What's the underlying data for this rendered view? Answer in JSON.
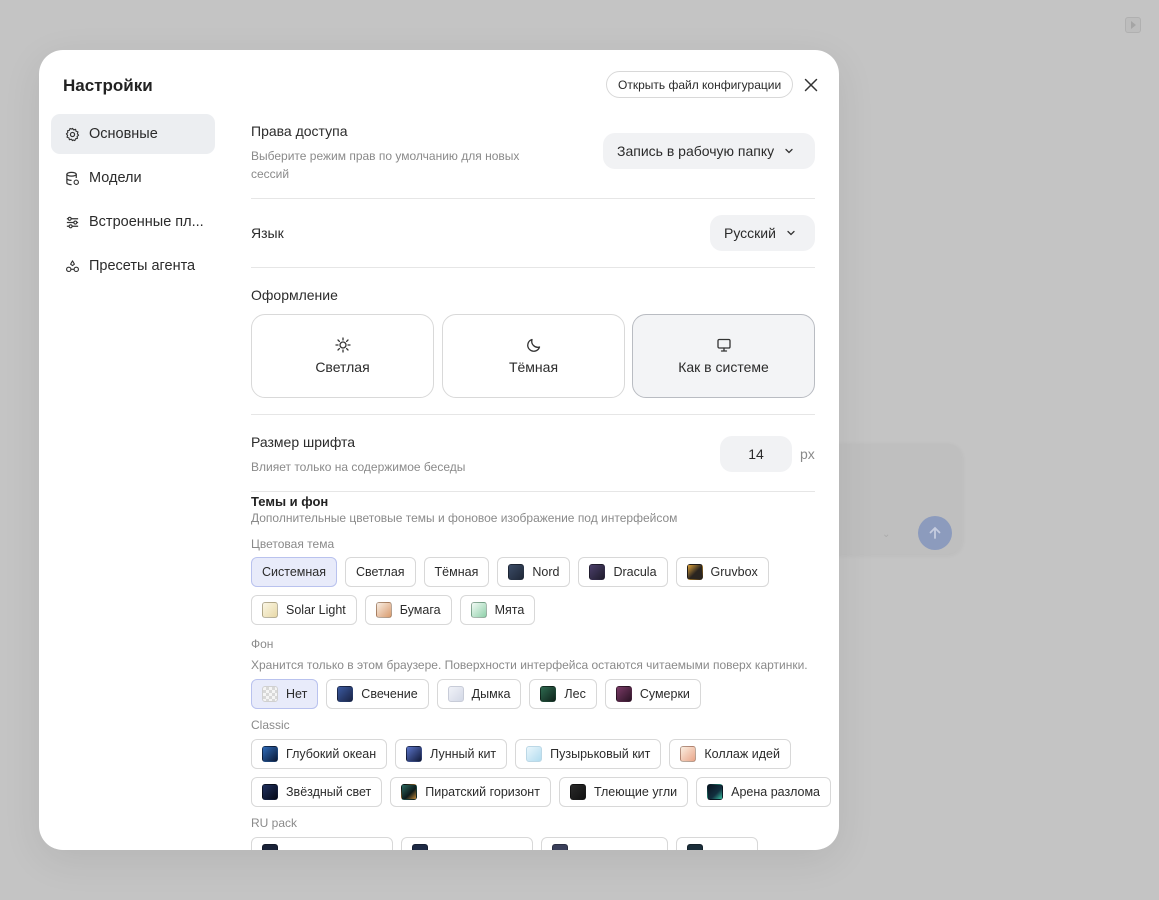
{
  "modal": {
    "title": "Настройки",
    "open_config_label": "Открыть файл конфигурации"
  },
  "sidebar": {
    "items": [
      {
        "label": "Основные",
        "icon": "gear-icon",
        "active": true
      },
      {
        "label": "Модели",
        "icon": "database-icon",
        "active": false
      },
      {
        "label": "Встроенные пл...",
        "icon": "sliders-icon",
        "active": false
      },
      {
        "label": "Пресеты агента",
        "icon": "agent-icon",
        "active": false
      }
    ]
  },
  "permissions": {
    "label": "Права доступа",
    "description": "Выберите режим прав по умолчанию для новых сессий",
    "value": "Запись в рабочую папку"
  },
  "language": {
    "label": "Язык",
    "value": "Русский"
  },
  "appearance": {
    "label": "Оформление",
    "options": [
      {
        "label": "Светлая",
        "icon": "sun-icon"
      },
      {
        "label": "Тёмная",
        "icon": "moon-icon"
      },
      {
        "label": "Как в системе",
        "icon": "monitor-icon",
        "selected": true
      }
    ]
  },
  "font_size": {
    "label": "Размер шрифта",
    "description": "Влияет только на содержимое беседы",
    "value": "14",
    "unit": "px"
  },
  "themes": {
    "title": "Темы и фон",
    "description": "Дополнительные цветовые темы и фоновое изображение под интерфейсом",
    "color_theme_label": "Цветовая тема",
    "color_themes_row1": [
      {
        "label": "Системная",
        "active": true
      },
      {
        "label": "Светлая"
      },
      {
        "label": "Тёмная"
      },
      {
        "label": "Nord",
        "swatch": "#2c3648"
      },
      {
        "label": "Dracula",
        "swatch": "#2b2740"
      },
      {
        "label": "Gruvbox",
        "swatch": "#2f2a1f"
      }
    ],
    "color_themes_row2": [
      {
        "label": "Solar Light",
        "swatch": "#f6efd6"
      },
      {
        "label": "Бумага",
        "swatch": "#f3e5d5"
      },
      {
        "label": "Мята",
        "swatch": "#dff2e6"
      }
    ],
    "background_label": "Фон",
    "background_description": "Хранится только в этом браузере. Поверхности интерфейса остаются читаемыми поверх картинки.",
    "backgrounds": [
      {
        "label": "Нет",
        "active": true
      },
      {
        "label": "Свечение",
        "swatch": "#22335e"
      },
      {
        "label": "Дымка",
        "swatch": "#e4e7f0"
      },
      {
        "label": "Лес",
        "swatch": "#1c3b2e"
      },
      {
        "label": "Сумерки",
        "swatch": "#4a2340"
      }
    ],
    "classic_label": "Classic",
    "classic_row1": [
      {
        "label": "Глубокий океан",
        "swatch": "#14305c"
      },
      {
        "label": "Лунный кит",
        "swatch": "#1d2a55"
      },
      {
        "label": "Пузырьковый кит",
        "swatch": "#d6ecf7"
      },
      {
        "label": "Коллаж идей",
        "swatch": "#f4e2d0"
      }
    ],
    "classic_row2": [
      {
        "label": "Звёздный свет",
        "swatch": "#0d1630"
      },
      {
        "label": "Пиратский горизонт",
        "swatch": "#13302e"
      },
      {
        "label": "Тлеющие угли",
        "swatch": "#1a1a1a"
      },
      {
        "label": "Арена разлома",
        "swatch": "#0c1a24"
      }
    ],
    "ru_pack_label": "RU pack"
  }
}
